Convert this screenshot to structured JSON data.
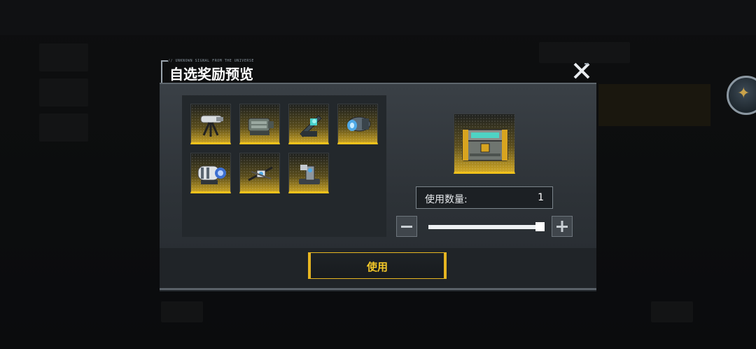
{
  "dialog": {
    "title": "自选奖励预览",
    "title_caption": "// UNKNOWN SIGNAL FROM THE UNIVERSE",
    "close_icon": "close-x-icon"
  },
  "rewards": {
    "items": [
      {
        "name": "tripod-turret-part",
        "icon": "turret-tripod-icon"
      },
      {
        "name": "cannon-module",
        "icon": "cannon-module-icon"
      },
      {
        "name": "launcher-module",
        "icon": "launcher-icon"
      },
      {
        "name": "thruster-module",
        "icon": "thruster-icon"
      },
      {
        "name": "reactor-module",
        "icon": "reactor-icon"
      },
      {
        "name": "drone-module",
        "icon": "drone-icon"
      },
      {
        "name": "mount-module",
        "icon": "mount-icon"
      }
    ],
    "slot_accent": "#f1c21b"
  },
  "selected_item": {
    "icon": "supply-chest-icon"
  },
  "quantity": {
    "label": "使用数量:",
    "value": "1",
    "slider_level": 1.0
  },
  "controls": {
    "minus_glyph": "—",
    "plus_glyph": "+"
  },
  "use_button": {
    "label": "使用",
    "accent": "#f3c728"
  }
}
